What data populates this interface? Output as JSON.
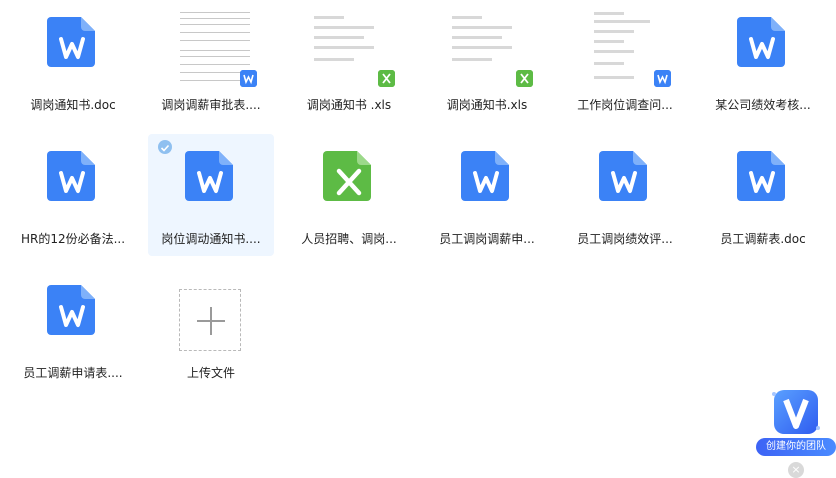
{
  "files": [
    {
      "name": "调岗通知书.doc",
      "kind": "word"
    },
    {
      "name": "调岗调薪审批表....",
      "kind": "preview-word"
    },
    {
      "name": "调岗通知书 .xls",
      "kind": "preview-excel"
    },
    {
      "name": "调岗通知书.xls",
      "kind": "preview-excel"
    },
    {
      "name": "工作岗位调查问...",
      "kind": "preview-word"
    },
    {
      "name": "某公司绩效考核...",
      "kind": "word"
    },
    {
      "name": "HR的12份必备法...",
      "kind": "word"
    },
    {
      "name": "岗位调动通知书....",
      "kind": "word",
      "selected": true
    },
    {
      "name": "人员招聘、调岗...",
      "kind": "excel"
    },
    {
      "name": "员工调岗调薪申...",
      "kind": "word"
    },
    {
      "name": "员工调岗绩效评...",
      "kind": "word"
    },
    {
      "name": "员工调薪表.doc",
      "kind": "word"
    },
    {
      "name": "员工调薪申请表....",
      "kind": "word"
    }
  ],
  "upload": {
    "label": "上传文件"
  },
  "team_widget": {
    "label": "创建你的团队",
    "close": "×"
  },
  "colors": {
    "word": "#3b82f6",
    "excel": "#5dbb45",
    "selected_bg": "#eef6ff"
  }
}
